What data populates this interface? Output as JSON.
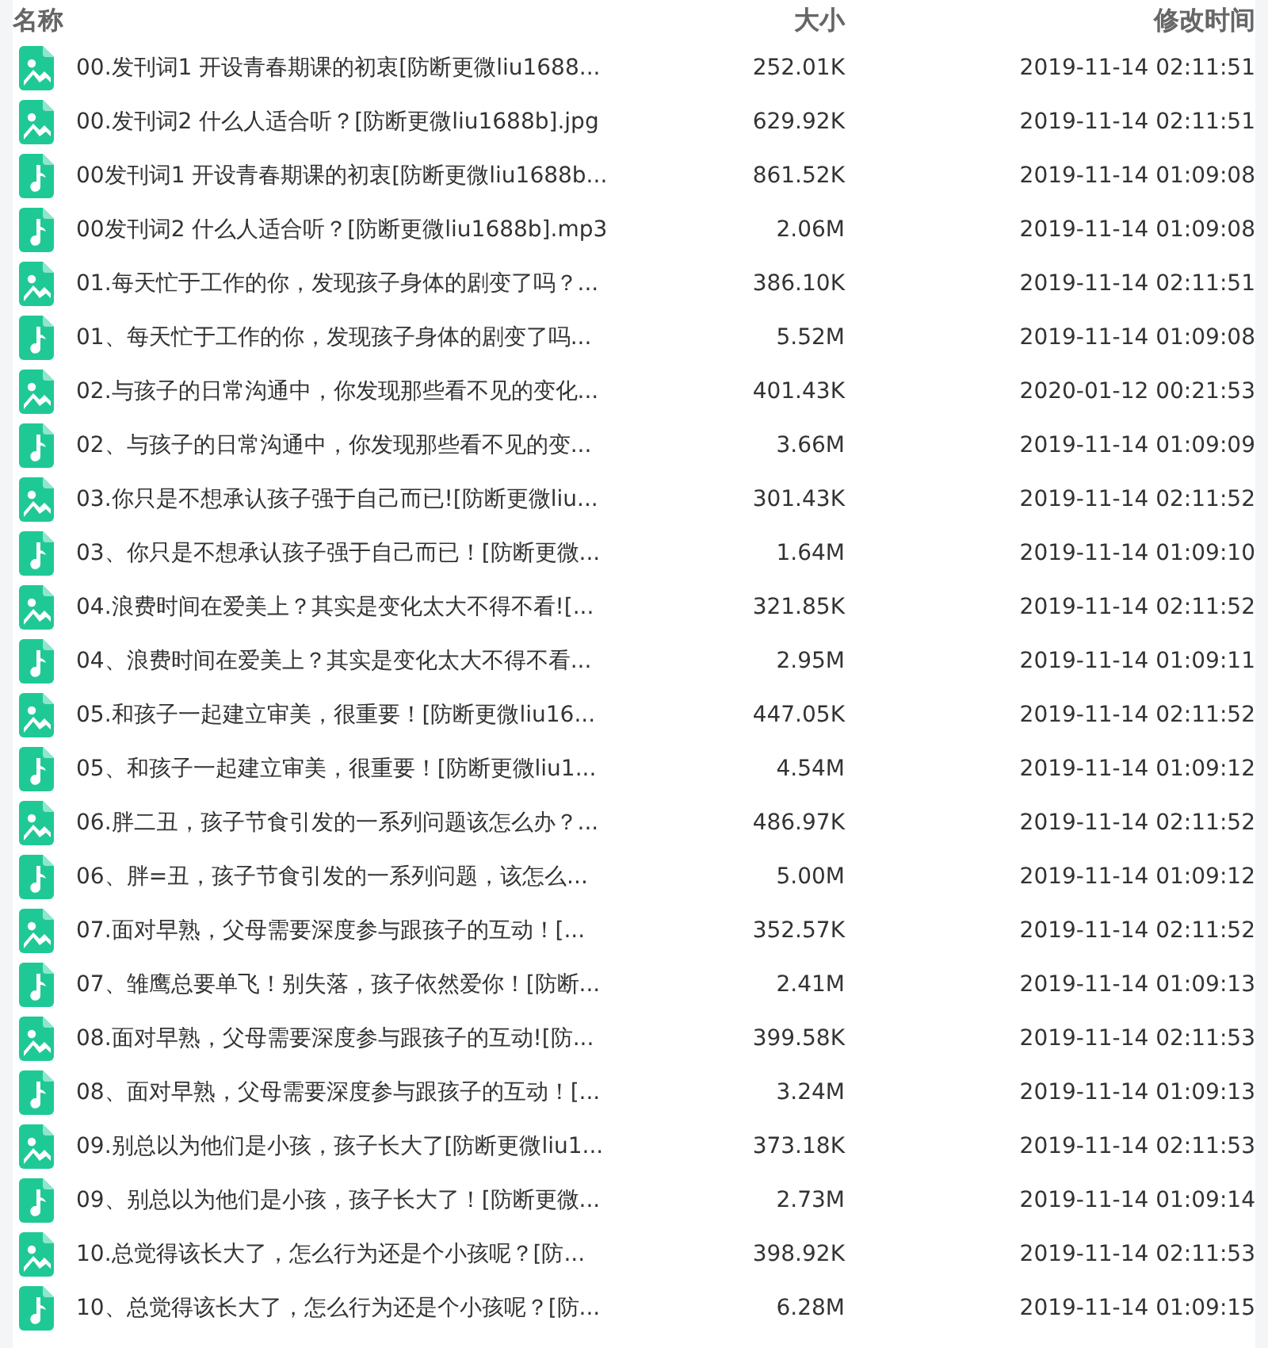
{
  "columns": [
    "名称",
    "大小",
    "修改时间"
  ],
  "files": [
    {
      "kind": "image",
      "name": "00.发刊词1 开设青春期课的初衷[防断更微liu1688...",
      "size": "252.01K",
      "modified": "2019-11-14 02:11:51"
    },
    {
      "kind": "image",
      "name": "00.发刊词2 什么人适合听？[防断更微liu1688b].jpg",
      "size": "629.92K",
      "modified": "2019-11-14 02:11:51"
    },
    {
      "kind": "audio",
      "name": "00发刊词1 开设青春期课的初衷[防断更微liu1688b...",
      "size": "861.52K",
      "modified": "2019-11-14 01:09:08"
    },
    {
      "kind": "audio",
      "name": "00发刊词2 什么人适合听？[防断更微liu1688b].mp3",
      "size": "2.06M",
      "modified": "2019-11-14 01:09:08"
    },
    {
      "kind": "image",
      "name": "01.每天忙于工作的你，发现孩子身体的剧变了吗？...",
      "size": "386.10K",
      "modified": "2019-11-14 02:11:51"
    },
    {
      "kind": "audio",
      "name": "01、每天忙于工作的你，发现孩子身体的剧变了吗...",
      "size": "5.52M",
      "modified": "2019-11-14 01:09:08"
    },
    {
      "kind": "image",
      "name": "02.与孩子的日常沟通中，你发现那些看不见的变化...",
      "size": "401.43K",
      "modified": "2020-01-12 00:21:53"
    },
    {
      "kind": "audio",
      "name": "02、与孩子的日常沟通中，你发现那些看不见的变...",
      "size": "3.66M",
      "modified": "2019-11-14 01:09:09"
    },
    {
      "kind": "image",
      "name": "03.你只是不想承认孩子强于自己而已![防断更微liu...",
      "size": "301.43K",
      "modified": "2019-11-14 02:11:52"
    },
    {
      "kind": "audio",
      "name": "03、你只是不想承认孩子强于自己而已！[防断更微...",
      "size": "1.64M",
      "modified": "2019-11-14 01:09:10"
    },
    {
      "kind": "image",
      "name": "04.浪费时间在爱美上？其实是变化太大不得不看![...",
      "size": "321.85K",
      "modified": "2019-11-14 02:11:52"
    },
    {
      "kind": "audio",
      "name": "04、浪费时间在爱美上？其实是变化太大不得不看...",
      "size": "2.95M",
      "modified": "2019-11-14 01:09:11"
    },
    {
      "kind": "image",
      "name": "05.和孩子一起建立审美，很重要！[防断更微liu16...",
      "size": "447.05K",
      "modified": "2019-11-14 02:11:52"
    },
    {
      "kind": "audio",
      "name": "05、和孩子一起建立审美，很重要！[防断更微liu1...",
      "size": "4.54M",
      "modified": "2019-11-14 01:09:12"
    },
    {
      "kind": "image",
      "name": "06.胖二丑，孩子节食引发的一系列问题该怎么办？...",
      "size": "486.97K",
      "modified": "2019-11-14 02:11:52"
    },
    {
      "kind": "audio",
      "name": "06、胖=丑，孩子节食引发的一系列问题，该怎么...",
      "size": "5.00M",
      "modified": "2019-11-14 01:09:12"
    },
    {
      "kind": "image",
      "name": "07.面对早熟，父母需要深度参与跟孩子的互动！[...",
      "size": "352.57K",
      "modified": "2019-11-14 02:11:52"
    },
    {
      "kind": "audio",
      "name": "07、雏鹰总要单飞！别失落，孩子依然爱你！[防断...",
      "size": "2.41M",
      "modified": "2019-11-14 01:09:13"
    },
    {
      "kind": "image",
      "name": "08.面对早熟，父母需要深度参与跟孩子的互动![防...",
      "size": "399.58K",
      "modified": "2019-11-14 02:11:53"
    },
    {
      "kind": "audio",
      "name": "08、面对早熟，父母需要深度参与跟孩子的互动！[...",
      "size": "3.24M",
      "modified": "2019-11-14 01:09:13"
    },
    {
      "kind": "image",
      "name": "09.别总以为他们是小孩，孩子长大了[防断更微liu1...",
      "size": "373.18K",
      "modified": "2019-11-14 02:11:53"
    },
    {
      "kind": "audio",
      "name": "09、别总以为他们是小孩，孩子长大了！[防断更微...",
      "size": "2.73M",
      "modified": "2019-11-14 01:09:14"
    },
    {
      "kind": "image",
      "name": "10.总觉得该长大了，怎么行为还是个小孩呢？[防...",
      "size": "398.92K",
      "modified": "2019-11-14 02:11:53"
    },
    {
      "kind": "audio",
      "name": "10、总觉得该长大了，怎么行为还是个小孩呢？[防...",
      "size": "6.28M",
      "modified": "2019-11-14 01:09:15"
    }
  ]
}
